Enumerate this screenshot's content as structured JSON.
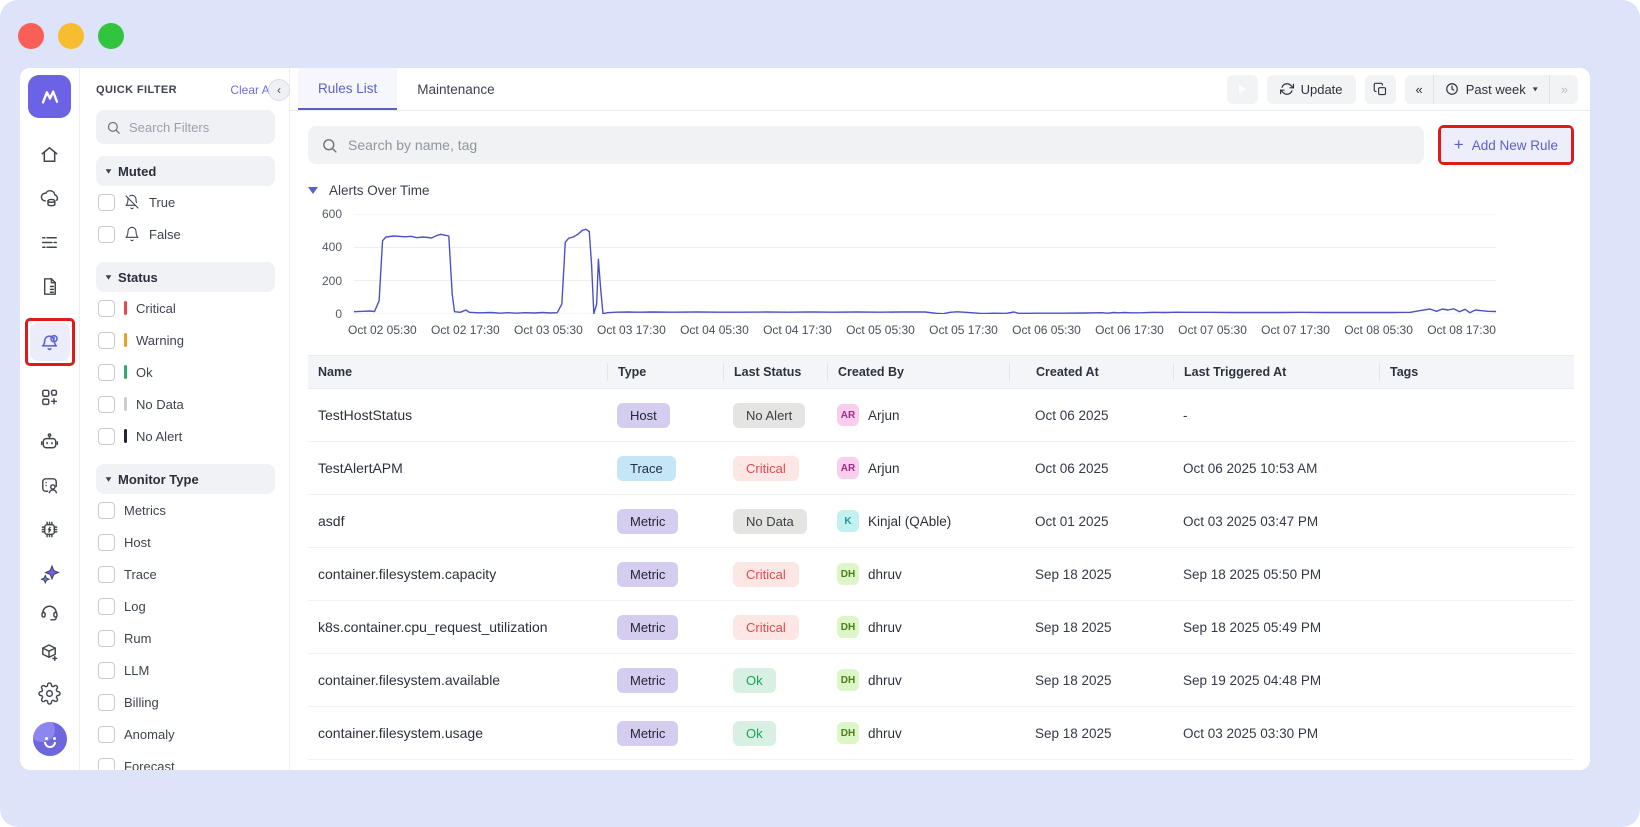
{
  "annotations": {
    "highlight_color": "#de1b1b"
  },
  "window": {
    "traffic_lights": [
      "#f95f56",
      "#f6bd2f",
      "#32c33f"
    ]
  },
  "sidebar": {
    "items": [
      "logo",
      "home",
      "infrastructure",
      "logs",
      "reports",
      "alerts",
      "dashboards",
      "bot",
      "user-sessions",
      "processors",
      "ai-assistant",
      "support",
      "integrations",
      "settings",
      "profile"
    ],
    "active_item": "alerts"
  },
  "filter_panel": {
    "title": "QUICK FILTER",
    "clear_all_label": "Clear All",
    "search_placeholder": "Search Filters",
    "sections": [
      {
        "label": "Muted",
        "items": [
          {
            "label": "True",
            "icon": "bell-off-icon"
          },
          {
            "label": "False",
            "icon": "bell-icon"
          }
        ]
      },
      {
        "label": "Status",
        "items": [
          {
            "label": "Critical",
            "color": "#e5484d"
          },
          {
            "label": "Warning",
            "color": "#f0a020"
          },
          {
            "label": "Ok",
            "color": "#2fa96f"
          },
          {
            "label": "No Data",
            "color": "#c9ccd2"
          },
          {
            "label": "No Alert",
            "color": "#23262e"
          }
        ]
      },
      {
        "label": "Monitor Type",
        "items": [
          {
            "label": "Metrics"
          },
          {
            "label": "Host"
          },
          {
            "label": "Trace"
          },
          {
            "label": "Log"
          },
          {
            "label": "Rum"
          },
          {
            "label": "LLM"
          },
          {
            "label": "Billing"
          },
          {
            "label": "Anomaly"
          },
          {
            "label": "Forecast"
          }
        ]
      }
    ]
  },
  "topbar": {
    "tabs": [
      {
        "label": "Rules List",
        "active": true
      },
      {
        "label": "Maintenance",
        "active": false
      }
    ],
    "update_label": "Update",
    "time_range": "Past week"
  },
  "toolbar": {
    "search_placeholder": "Search by name, tag",
    "add_rule_label": "Add New Rule"
  },
  "chart_data": {
    "type": "line",
    "title": "Alerts Over Time",
    "line_color": "#4c51c6",
    "ylim": [
      0,
      600
    ],
    "y_ticks": [
      600,
      400,
      200,
      0
    ],
    "grid": true,
    "x_labels": [
      "Oct 02 05:30",
      "Oct 02 17:30",
      "Oct 03 05:30",
      "Oct 03 17:30",
      "Oct 04 05:30",
      "Oct 04 17:30",
      "Oct 05 05:30",
      "Oct 05 17:30",
      "Oct 06 05:30",
      "Oct 06 17:30",
      "Oct 07 05:30",
      "Oct 07 17:30",
      "Oct 08 05:30",
      "Oct 08 17:30"
    ],
    "series": [
      {
        "name": "alerts",
        "points": [
          [
            0.0,
            14
          ],
          [
            0.008,
            16
          ],
          [
            0.014,
            18
          ],
          [
            0.018,
            15
          ],
          [
            0.022,
            80
          ],
          [
            0.025,
            440
          ],
          [
            0.028,
            462
          ],
          [
            0.035,
            468
          ],
          [
            0.045,
            463
          ],
          [
            0.05,
            466
          ],
          [
            0.055,
            458
          ],
          [
            0.06,
            462
          ],
          [
            0.065,
            459
          ],
          [
            0.068,
            456
          ],
          [
            0.072,
            470
          ],
          [
            0.076,
            478
          ],
          [
            0.08,
            472
          ],
          [
            0.083,
            468
          ],
          [
            0.086,
            120
          ],
          [
            0.088,
            14
          ],
          [
            0.093,
            10
          ],
          [
            0.098,
            24
          ],
          [
            0.101,
            10
          ],
          [
            0.11,
            7
          ],
          [
            0.12,
            9
          ],
          [
            0.128,
            5
          ],
          [
            0.135,
            8
          ],
          [
            0.142,
            5
          ],
          [
            0.15,
            8
          ],
          [
            0.158,
            6
          ],
          [
            0.165,
            9
          ],
          [
            0.172,
            6
          ],
          [
            0.178,
            8
          ],
          [
            0.182,
            60
          ],
          [
            0.185,
            430
          ],
          [
            0.188,
            455
          ],
          [
            0.192,
            462
          ],
          [
            0.196,
            478
          ],
          [
            0.2,
            502
          ],
          [
            0.203,
            508
          ],
          [
            0.206,
            495
          ],
          [
            0.208,
            300
          ],
          [
            0.21,
            2
          ],
          [
            0.2125,
            60
          ],
          [
            0.214,
            328
          ],
          [
            0.216,
            150
          ],
          [
            0.218,
            2
          ],
          [
            0.222,
            8
          ],
          [
            0.23,
            11
          ],
          [
            0.24,
            12
          ],
          [
            0.25,
            11
          ],
          [
            0.26,
            12
          ],
          [
            0.28,
            11
          ],
          [
            0.3,
            12
          ],
          [
            0.32,
            11
          ],
          [
            0.34,
            11
          ],
          [
            0.36,
            12
          ],
          [
            0.38,
            11
          ],
          [
            0.4,
            12
          ],
          [
            0.42,
            11
          ],
          [
            0.44,
            12
          ],
          [
            0.46,
            11
          ],
          [
            0.48,
            12
          ],
          [
            0.5,
            12
          ],
          [
            0.51,
            4
          ],
          [
            0.516,
            2
          ],
          [
            0.522,
            10
          ],
          [
            0.528,
            13
          ],
          [
            0.534,
            11
          ],
          [
            0.54,
            8
          ],
          [
            0.548,
            4
          ],
          [
            0.554,
            3
          ],
          [
            0.56,
            5
          ],
          [
            0.566,
            4
          ],
          [
            0.572,
            5
          ],
          [
            0.578,
            12
          ],
          [
            0.582,
            4
          ],
          [
            0.59,
            4
          ],
          [
            0.6,
            5
          ],
          [
            0.62,
            5
          ],
          [
            0.64,
            6
          ],
          [
            0.655,
            8
          ],
          [
            0.66,
            5
          ],
          [
            0.665,
            9
          ],
          [
            0.67,
            7
          ],
          [
            0.675,
            9
          ],
          [
            0.68,
            7
          ],
          [
            0.69,
            8
          ],
          [
            0.7,
            10
          ],
          [
            0.71,
            9
          ],
          [
            0.72,
            11
          ],
          [
            0.73,
            10
          ],
          [
            0.75,
            10
          ],
          [
            0.77,
            9
          ],
          [
            0.79,
            9
          ],
          [
            0.81,
            9
          ],
          [
            0.83,
            10
          ],
          [
            0.85,
            9
          ],
          [
            0.87,
            9
          ],
          [
            0.89,
            9
          ],
          [
            0.91,
            9
          ],
          [
            0.925,
            10
          ],
          [
            0.935,
            22
          ],
          [
            0.942,
            30
          ],
          [
            0.948,
            16
          ],
          [
            0.953,
            30
          ],
          [
            0.958,
            24
          ],
          [
            0.963,
            31
          ],
          [
            0.968,
            14
          ],
          [
            0.973,
            28
          ],
          [
            0.977,
            8
          ],
          [
            0.982,
            24
          ],
          [
            0.987,
            20
          ],
          [
            0.993,
            16
          ],
          [
            1.0,
            15
          ]
        ]
      }
    ]
  },
  "table": {
    "columns": [
      "Name",
      "Type",
      "Last Status",
      "Created By",
      "Created At",
      "Last Triggered At",
      "Tags"
    ],
    "rows": [
      {
        "name": "TestHostStatus",
        "type": "Host",
        "type_style": "purple",
        "status": "No Alert",
        "status_style": "gray",
        "avatar": "AR",
        "avatar_style": "pink",
        "created_by": "Arjun",
        "created_at": "Oct 06 2025",
        "last_triggered_at": "-",
        "tags": ""
      },
      {
        "name": "TestAlertAPM",
        "type": "Trace",
        "type_style": "blue",
        "status": "Critical",
        "status_style": "red",
        "avatar": "AR",
        "avatar_style": "pink",
        "created_by": "Arjun",
        "created_at": "Oct 06 2025",
        "last_triggered_at": "Oct 06 2025 10:53 AM",
        "tags": ""
      },
      {
        "name": "asdf",
        "type": "Metric",
        "type_style": "purple",
        "status": "No Data",
        "status_style": "gray",
        "avatar": "K",
        "avatar_style": "cyan",
        "created_by": "Kinjal (QAble)",
        "created_at": "Oct 01 2025",
        "last_triggered_at": "Oct 03 2025 03:47 PM",
        "tags": ""
      },
      {
        "name": "container.filesystem.capacity",
        "type": "Metric",
        "type_style": "purple",
        "status": "Critical",
        "status_style": "red",
        "avatar": "DH",
        "avatar_style": "green",
        "created_by": "dhruv",
        "created_at": "Sep 18 2025",
        "last_triggered_at": "Sep 18 2025 05:50 PM",
        "tags": ""
      },
      {
        "name": "k8s.container.cpu_request_utilization",
        "type": "Metric",
        "type_style": "purple",
        "status": "Critical",
        "status_style": "red",
        "avatar": "DH",
        "avatar_style": "green",
        "created_by": "dhruv",
        "created_at": "Sep 18 2025",
        "last_triggered_at": "Sep 18 2025 05:49 PM",
        "tags": ""
      },
      {
        "name": "container.filesystem.available",
        "type": "Metric",
        "type_style": "purple",
        "status": "Ok",
        "status_style": "green",
        "avatar": "DH",
        "avatar_style": "green",
        "created_by": "dhruv",
        "created_at": "Sep 18 2025",
        "last_triggered_at": "Sep 19 2025 04:48 PM",
        "tags": ""
      },
      {
        "name": "container.filesystem.usage",
        "type": "Metric",
        "type_style": "purple",
        "status": "Ok",
        "status_style": "green",
        "avatar": "DH",
        "avatar_style": "green",
        "created_by": "dhruv",
        "created_at": "Sep 18 2025",
        "last_triggered_at": "Oct 03 2025 03:30 PM",
        "tags": ""
      }
    ]
  }
}
